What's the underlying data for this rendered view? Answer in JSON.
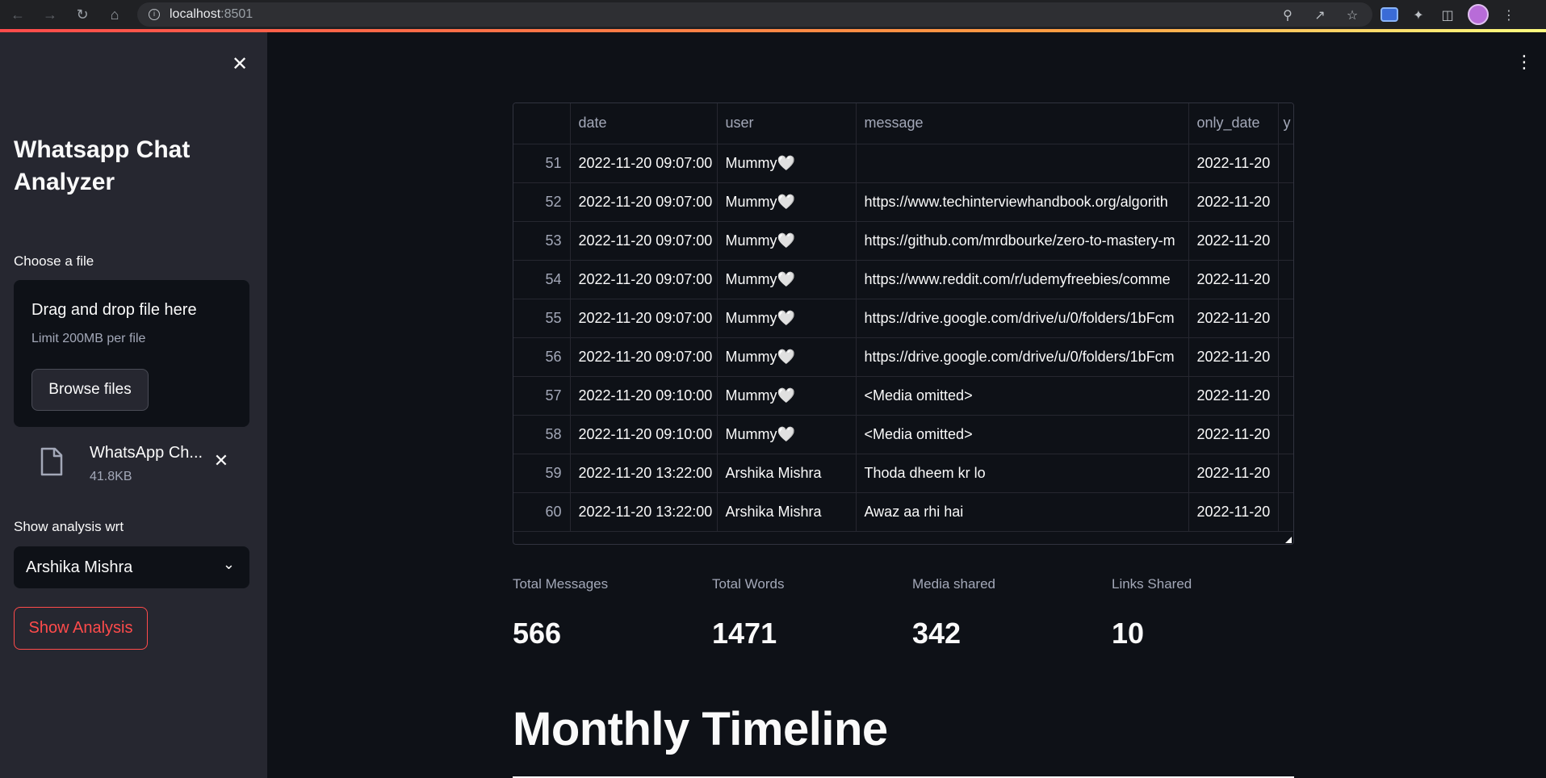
{
  "browser": {
    "url_host": "localhost",
    "url_port": ":8501"
  },
  "sidebar": {
    "title": "Whatsapp Chat Analyzer",
    "file_uploader": {
      "label": "Choose a file",
      "drop_text": "Drag and drop file here",
      "limit_text": "Limit 200MB per file",
      "browse_label": "Browse files",
      "uploaded_file": {
        "name": "WhatsApp Ch...",
        "size": "41.8KB"
      }
    },
    "select": {
      "label": "Show analysis wrt",
      "value": "Arshika Mishra"
    },
    "show_button": "Show Analysis"
  },
  "dataframe": {
    "columns": [
      "",
      "date",
      "user",
      "message",
      "only_date",
      "y"
    ],
    "rows": [
      [
        "51",
        "2022-11-20 09:07:00",
        "Mummy🤍",
        "",
        "2022-11-20"
      ],
      [
        "52",
        "2022-11-20 09:07:00",
        "Mummy🤍",
        "https://www.techinterviewhandbook.org/algorith",
        "2022-11-20"
      ],
      [
        "53",
        "2022-11-20 09:07:00",
        "Mummy🤍",
        "https://github.com/mrdbourke/zero-to-mastery-m",
        "2022-11-20"
      ],
      [
        "54",
        "2022-11-20 09:07:00",
        "Mummy🤍",
        "https://www.reddit.com/r/udemyfreebies/comme",
        "2022-11-20"
      ],
      [
        "55",
        "2022-11-20 09:07:00",
        "Mummy🤍",
        "https://drive.google.com/drive/u/0/folders/1bFcm",
        "2022-11-20"
      ],
      [
        "56",
        "2022-11-20 09:07:00",
        "Mummy🤍",
        "https://drive.google.com/drive/u/0/folders/1bFcm",
        "2022-11-20"
      ],
      [
        "57",
        "2022-11-20 09:10:00",
        "Mummy🤍",
        "<Media omitted>",
        "2022-11-20"
      ],
      [
        "58",
        "2022-11-20 09:10:00",
        "Mummy🤍",
        "<Media omitted>",
        "2022-11-20"
      ],
      [
        "59",
        "2022-11-20 13:22:00",
        "Arshika Mishra",
        "Thoda dheem kr lo",
        "2022-11-20"
      ],
      [
        "60",
        "2022-11-20 13:22:00",
        "Arshika Mishra",
        "Awaz aa rhi hai",
        "2022-11-20"
      ]
    ]
  },
  "metrics": [
    {
      "label": "Total Messages",
      "value": "566"
    },
    {
      "label": "Total Words",
      "value": "1471"
    },
    {
      "label": "Media shared",
      "value": "342"
    },
    {
      "label": "Links Shared",
      "value": "10"
    }
  ],
  "section_title": "Monthly Timeline",
  "colors": {
    "background": "#0e1117",
    "sidebar": "#262730",
    "accent": "#ff4b4b",
    "text": "#fafafa",
    "muted_text": "#a3a8b8"
  },
  "icons": {
    "sidebar_close": "close-icon",
    "file": "file-icon",
    "remove_file": "close-icon",
    "select": "chevron-down-icon",
    "main_menu": "kebab-menu-icon"
  }
}
